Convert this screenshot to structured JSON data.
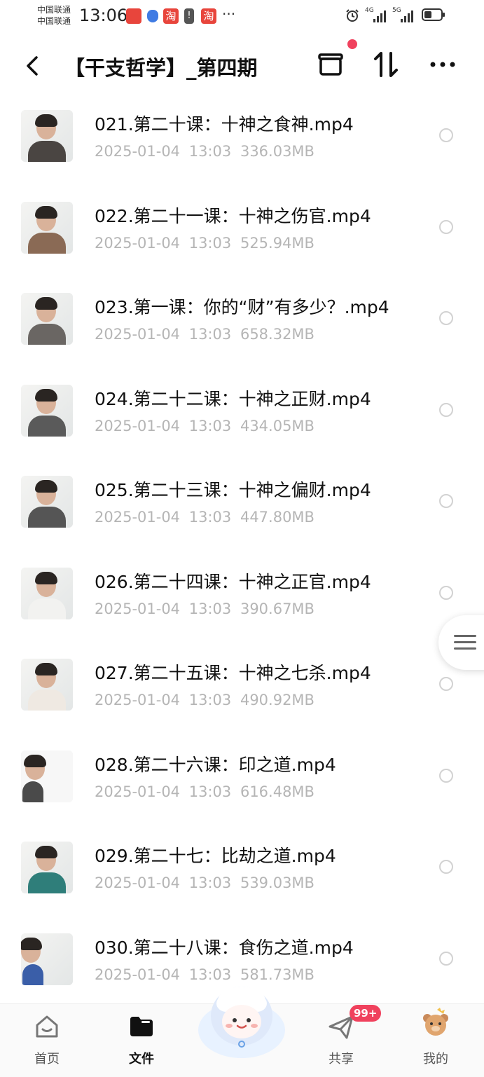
{
  "status_bar": {
    "carrier_1": "中国联通",
    "carrier_2": "中国联通",
    "time": "13:06",
    "net_1": "4G",
    "net_2": "5G",
    "tao_glyph": "淘",
    "bat_glyph": "!",
    "more": "···"
  },
  "header": {
    "title": "【干支哲学】_第四期",
    "back_icon": "chevron-left-icon",
    "box_icon": "archive-box-icon",
    "sort_icon": "sort-icon",
    "more_icon": "more-horizontal-icon"
  },
  "files": [
    {
      "name": "021.第二十课：十神之食神.mp4",
      "date": "2025-01-04",
      "time": "13:03",
      "size": "336.03MB"
    },
    {
      "name": "022.第二十一课：十神之伤官.mp4",
      "date": "2025-01-04",
      "time": "13:03",
      "size": "525.94MB"
    },
    {
      "name": "023.第一课：你的“财”有多少？.mp4",
      "date": "2025-01-04",
      "time": "13:03",
      "size": "658.32MB"
    },
    {
      "name": "024.第二十二课：十神之正财.mp4",
      "date": "2025-01-04",
      "time": "13:03",
      "size": "434.05MB"
    },
    {
      "name": "025.第二十三课：十神之偏财.mp4",
      "date": "2025-01-04",
      "time": "13:03",
      "size": "447.80MB"
    },
    {
      "name": "026.第二十四课：十神之正官.mp4",
      "date": "2025-01-04",
      "time": "13:03",
      "size": "390.67MB"
    },
    {
      "name": "027.第二十五课：十神之七杀.mp4",
      "date": "2025-01-04",
      "time": "13:03",
      "size": "490.92MB"
    },
    {
      "name": "028.第二十六课：印之道.mp4",
      "date": "2025-01-04",
      "time": "13:03",
      "size": "616.48MB"
    },
    {
      "name": "029.第二十七：比劫之道.mp4",
      "date": "2025-01-04",
      "time": "13:03",
      "size": "539.03MB"
    },
    {
      "name": "030.第二十八课：食伤之道.mp4",
      "date": "2025-01-04",
      "time": "13:03",
      "size": "581.73MB"
    }
  ],
  "bottom_nav": {
    "home": "首页",
    "files": "文件",
    "share": "共享",
    "mine": "我的",
    "share_badge": "99+"
  },
  "colors": {
    "accent_red": "#f0415d",
    "meta_gray": "#b5b5b5"
  }
}
